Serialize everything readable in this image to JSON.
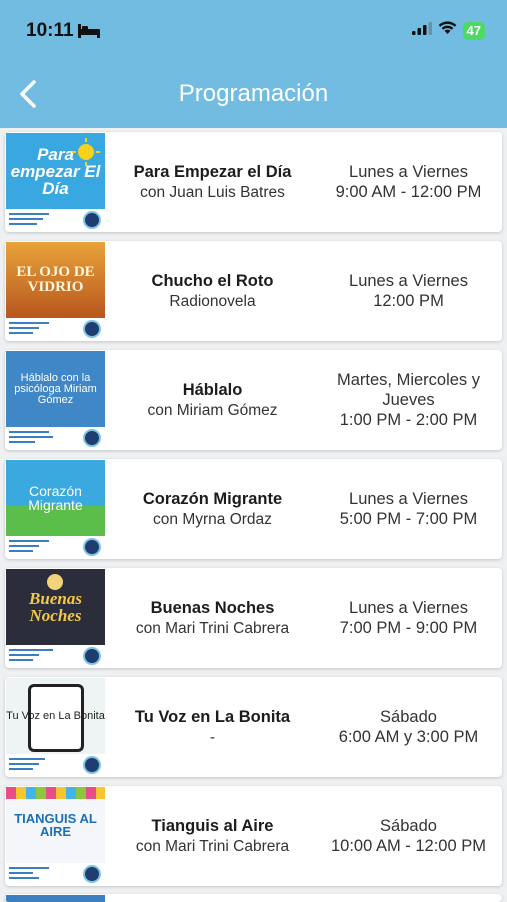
{
  "status_bar": {
    "time": "10:11",
    "battery": "47"
  },
  "header": {
    "title": "Programación"
  },
  "programs": [
    {
      "name": "Para Empezar el Día",
      "host": "con Juan Luis Batres",
      "days": "Lunes a Viernes",
      "hours": "9:00 AM - 12:00 PM",
      "art_text": "Para empezar El Día"
    },
    {
      "name": "Chucho el Roto",
      "host": "Radionovela",
      "days": "Lunes a Viernes",
      "hours": "12:00 PM",
      "art_text": "EL OJO DE VIDRIO"
    },
    {
      "name": "Háblalo",
      "host": "con Miriam Gómez",
      "days": "Martes, Miercoles y Jueves",
      "hours": "1:00 PM - 2:00 PM",
      "art_text": "Háblalo con la psicóloga Miriam Gómez"
    },
    {
      "name": "Corazón Migrante",
      "host": "con Myrna Ordaz",
      "days": "Lunes a Viernes",
      "hours": "5:00 PM - 7:00 PM",
      "art_text": "Corazón Migrante"
    },
    {
      "name": "Buenas Noches",
      "host": "con Mari Trini Cabrera",
      "days": "Lunes a Viernes",
      "hours": "7:00 PM - 9:00 PM",
      "art_text": "Buenas Noches"
    },
    {
      "name": "Tu Voz en La Bonita",
      "host": "-",
      "days": "Sábado",
      "hours": "6:00 AM y 3:00 PM",
      "art_text": "Tu Voz en La Bonita"
    },
    {
      "name": "Tianguis al Aire",
      "host": "con Mari Trini Cabrera",
      "days": "Sábado",
      "hours": "10:00 AM - 12:00 PM",
      "art_text": "TIANGUIS AL AIRE"
    }
  ]
}
